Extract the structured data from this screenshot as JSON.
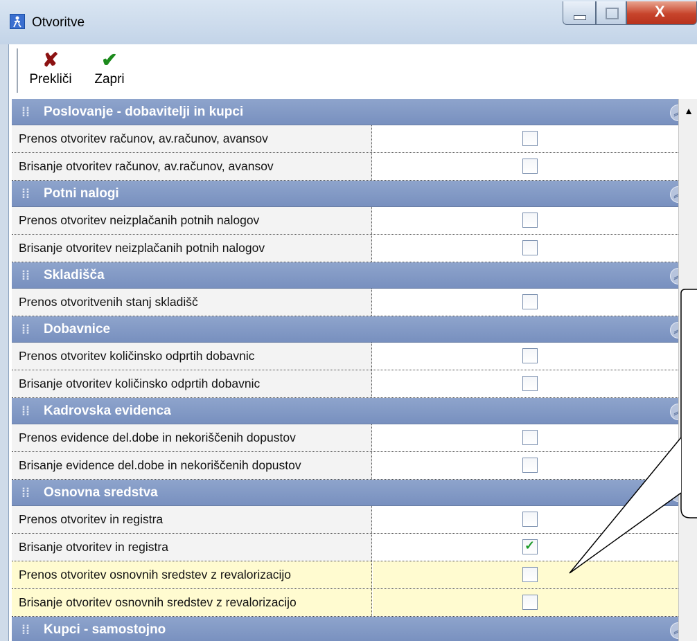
{
  "window": {
    "title": "Otvoritve",
    "close_glyph": "X"
  },
  "toolbar": {
    "cancel_label": "Prekliči",
    "cancel_icon": "red-x-icon",
    "close_label": "Zapri",
    "close_icon": "green-check-icon"
  },
  "sections": [
    {
      "title": "Poslovanje - dobavitelji in kupci",
      "rows": [
        {
          "label": "Prenos otvoritev računov, av.računov, avansov",
          "checked": false
        },
        {
          "label": "Brisanje otvoritev računov, av.računov, avansov",
          "checked": false
        }
      ]
    },
    {
      "title": "Potni nalogi",
      "rows": [
        {
          "label": "Prenos otvoritev neizplačanih potnih nalogov",
          "checked": false
        },
        {
          "label": "Brisanje otvoritev neizplačanih potnih nalogov",
          "checked": false
        }
      ]
    },
    {
      "title": "Skladišča",
      "rows": [
        {
          "label": "Prenos otvoritvenih stanj skladišč",
          "checked": false
        }
      ]
    },
    {
      "title": "Dobavnice",
      "rows": [
        {
          "label": "Prenos otvoritev količinsko odprtih dobavnic",
          "checked": false
        },
        {
          "label": "Brisanje otvoritev količinsko odprtih dobavnic",
          "checked": false
        }
      ]
    },
    {
      "title": "Kadrovska evidenca",
      "rows": [
        {
          "label": "Prenos evidence del.dobe in nekoriščenih dopustov",
          "checked": false
        },
        {
          "label": "Brisanje evidence del.dobe in nekoriščenih dopustov",
          "checked": false
        }
      ]
    },
    {
      "title": "Osnovna sredstva",
      "rows": [
        {
          "label": "Prenos otvoritev in registra",
          "checked": false
        },
        {
          "label": "Brisanje otvoritev in registra",
          "checked": true
        },
        {
          "label": "Prenos otvoritev osnovnih sredstev z revalorizacijo",
          "checked": false,
          "highlight": true
        },
        {
          "label": "Brisanje otvoritev osnovnih sredstev z revalorizacijo",
          "checked": false,
          "highlight": true
        }
      ]
    },
    {
      "title": "Kupci - samostojno",
      "rows": []
    }
  ],
  "colors": {
    "section_header": "#7f96c4",
    "highlight_row": "#fffbd0",
    "check_mark": "#1d9b2a"
  }
}
